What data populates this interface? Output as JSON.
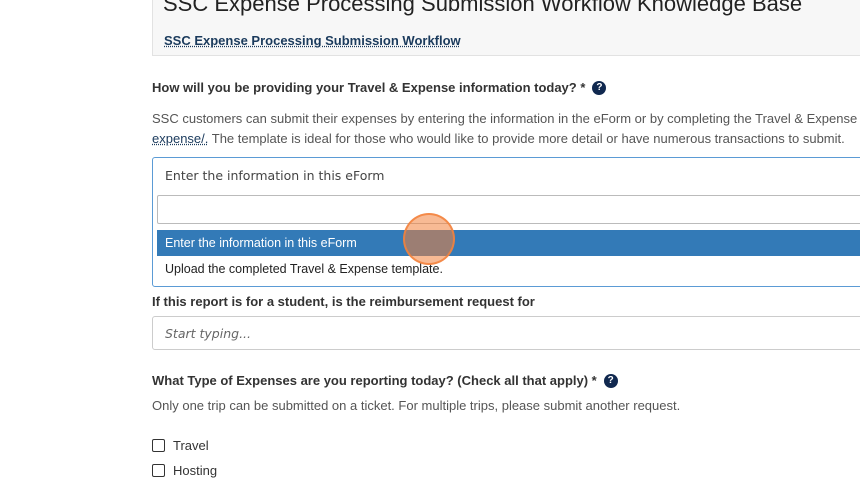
{
  "kb": {
    "title": "SSC Expense Processing Submission Workflow Knowledge Base",
    "link": "SSC Expense Processing Submission Workflow"
  },
  "question1": {
    "label": "How will you be providing your Travel & Expense information today? *",
    "help": "?",
    "desc_line1": "SSC customers can submit their expenses by entering the information in the eForm or by completing the Travel & Expense",
    "desc_link": "expense/.",
    "desc_line2_rest": " The template is ideal for those who would like to provide more detail or have numerous transactions to submit.",
    "current_value": "Enter the information in this eForm",
    "search_value": "",
    "options": [
      "Enter the information in this eForm",
      "Upload the completed Travel & Expense template."
    ],
    "selected_index": 0
  },
  "question2": {
    "label": "If this report is for a student, is the reimbursement request for",
    "placeholder": "Start typing..."
  },
  "question3": {
    "label": "What Type of Expenses are you reporting today? (Check all that apply) *",
    "help": "?",
    "hint": "Only one trip can be submitted on a ticket. For multiple trips, please submit another request.",
    "checkboxes": [
      "Travel",
      "Hosting"
    ]
  },
  "colors": {
    "selected_bg": "#337ab7",
    "focus_border": "#5b9bd5",
    "help_icon": "#10284f",
    "cursor_marker": "#f3823c"
  }
}
